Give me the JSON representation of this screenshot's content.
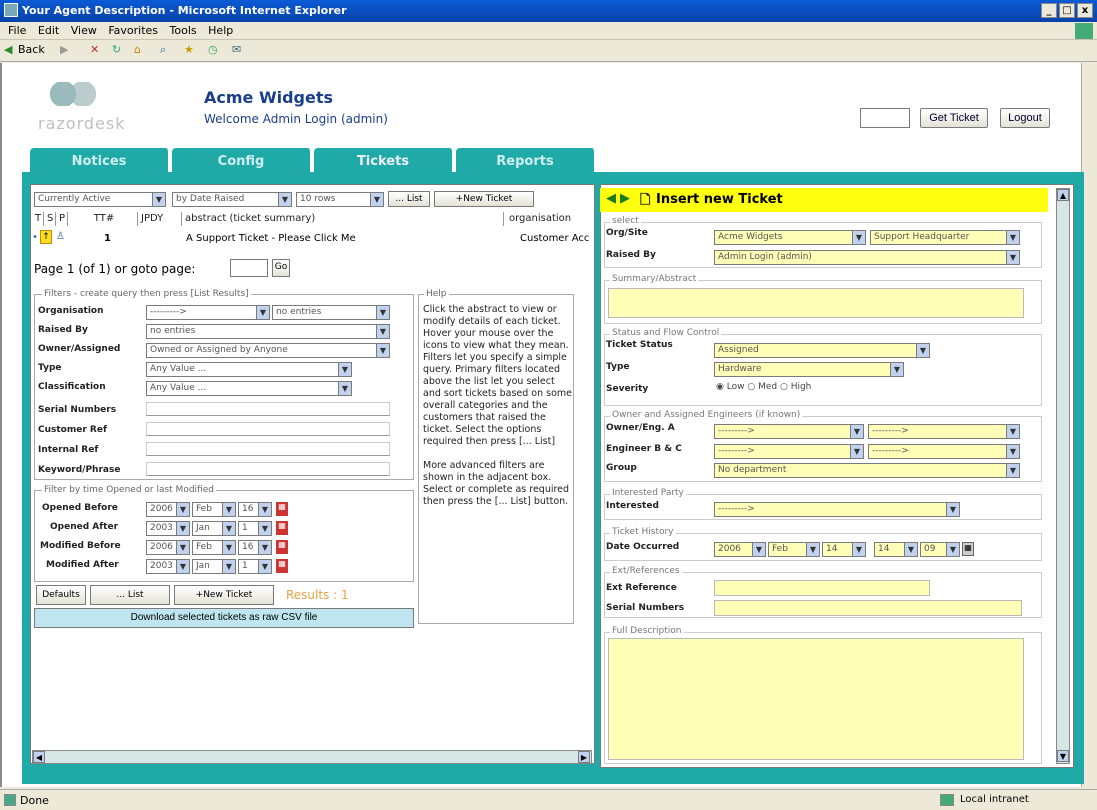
{
  "window": {
    "title": "Your Agent Description - Microsoft Internet Explorer",
    "controls": [
      "_",
      "□",
      "x"
    ]
  },
  "menu": [
    "File",
    "Edit",
    "View",
    "Favorites",
    "Tools",
    "Help"
  ],
  "toolbar": {
    "back": "Back"
  },
  "header": {
    "logo_text": "razordesk",
    "company": "Acme Widgets",
    "welcome": "Welcome Admin Login (admin)",
    "get_ticket": "Get Ticket",
    "logout": "Logout"
  },
  "tabs": [
    "Notices",
    "Config",
    "Tickets",
    "Reports"
  ],
  "list": {
    "filter_status": "Currently Active",
    "sort": "by Date Raised",
    "rows": "10 rows",
    "list_btn": "... List",
    "new_ticket": "+New Ticket",
    "columns": [
      "T",
      "S",
      "P",
      "TT#",
      "JPDY",
      "abstract (ticket summary)",
      "organisation"
    ],
    "ticket_num": "1",
    "ticket_abstract": "A Support Ticket - Please Click Me",
    "ticket_org": "Customer Acc",
    "paging": "Page 1 (of 1) or goto page:",
    "go": "Go"
  },
  "filters": {
    "legend": "Filters - create query then press [List Results]",
    "organisation_label": "Organisation",
    "organisation_value": "--------->",
    "organisation_value2": "no entries",
    "raised_by_label": "Raised By",
    "raised_by_value": "no entries",
    "owner_label": "Owner/Assigned",
    "owner_value": "Owned or Assigned by Anyone",
    "type_label": "Type",
    "type_value": "Any Value ...",
    "class_label": "Classification",
    "class_value": "Any Value ...",
    "serial_label": "Serial Numbers",
    "cust_ref_label": "Customer Ref",
    "internal_ref_label": "Internal Ref",
    "keyword_label": "Keyword/Phrase"
  },
  "time_filters": {
    "legend": "Filter by time Opened or last Modified",
    "rows": [
      {
        "label": "Opened Before",
        "y": "2006",
        "m": "Feb",
        "d": "16"
      },
      {
        "label": "Opened After",
        "y": "2003",
        "m": "Jan",
        "d": "1"
      },
      {
        "label": "Modified Before",
        "y": "2006",
        "m": "Feb",
        "d": "16"
      },
      {
        "label": "Modified After",
        "y": "2003",
        "m": "Jan",
        "d": "1"
      }
    ]
  },
  "bottom": {
    "defaults": "Defaults",
    "list": "... List",
    "new_ticket": "+New Ticket",
    "results": "Results : 1",
    "download": "Download selected tickets as raw CSV file"
  },
  "help": {
    "legend": "Help",
    "text": "Click the abstract to view or modify details of each ticket. Hover your mouse over the icons to view what they mean. Filters let you specify a simple query. Primary filters located above the list let you select and sort tickets based on some overall categories and the customers that raised the ticket. Select the options required then press [... List]",
    "text2": "More advanced filters are shown in the adjacent box. Select or complete as required then press the [... List] button."
  },
  "new_ticket": {
    "title": "Insert new Ticket",
    "select_legend": "select",
    "org_label": "Org/Site",
    "org_value": "Acme Widgets",
    "site_value": "Support Headquarter",
    "raised_by_label": "Raised By",
    "raised_by_value": "Admin Login (admin)",
    "summary_legend": "Summary/Abstract",
    "status_legend": "Status and Flow Control",
    "status_label": "Ticket Status",
    "status_value": "Assigned",
    "type_label": "Type",
    "type_value": "Hardware",
    "severity_label": "Severity",
    "severity_low": "Low",
    "severity_med": "Med",
    "severity_high": "High",
    "engineers_legend": "Owner and Assigned Engineers (if known)",
    "owner_label": "Owner/Eng. A",
    "owner_value": "--------->",
    "eng_bc_label": "Engineer B & C",
    "group_label": "Group",
    "group_value": "No department",
    "interested_legend": "Interested Party",
    "interested_label": "Interested",
    "interested_value": "--------->",
    "history_legend": "Ticket History",
    "date_label": "Date Occurred",
    "date_y": "2006",
    "date_m": "Feb",
    "date_d": "14",
    "date_h": "14",
    "date_min": "09",
    "ext_legend": "Ext/References",
    "ext_ref_label": "Ext Reference",
    "serial_label": "Serial Numbers",
    "desc_legend": "Full Description"
  },
  "status": {
    "left": "Done",
    "right": "Local intranet"
  }
}
